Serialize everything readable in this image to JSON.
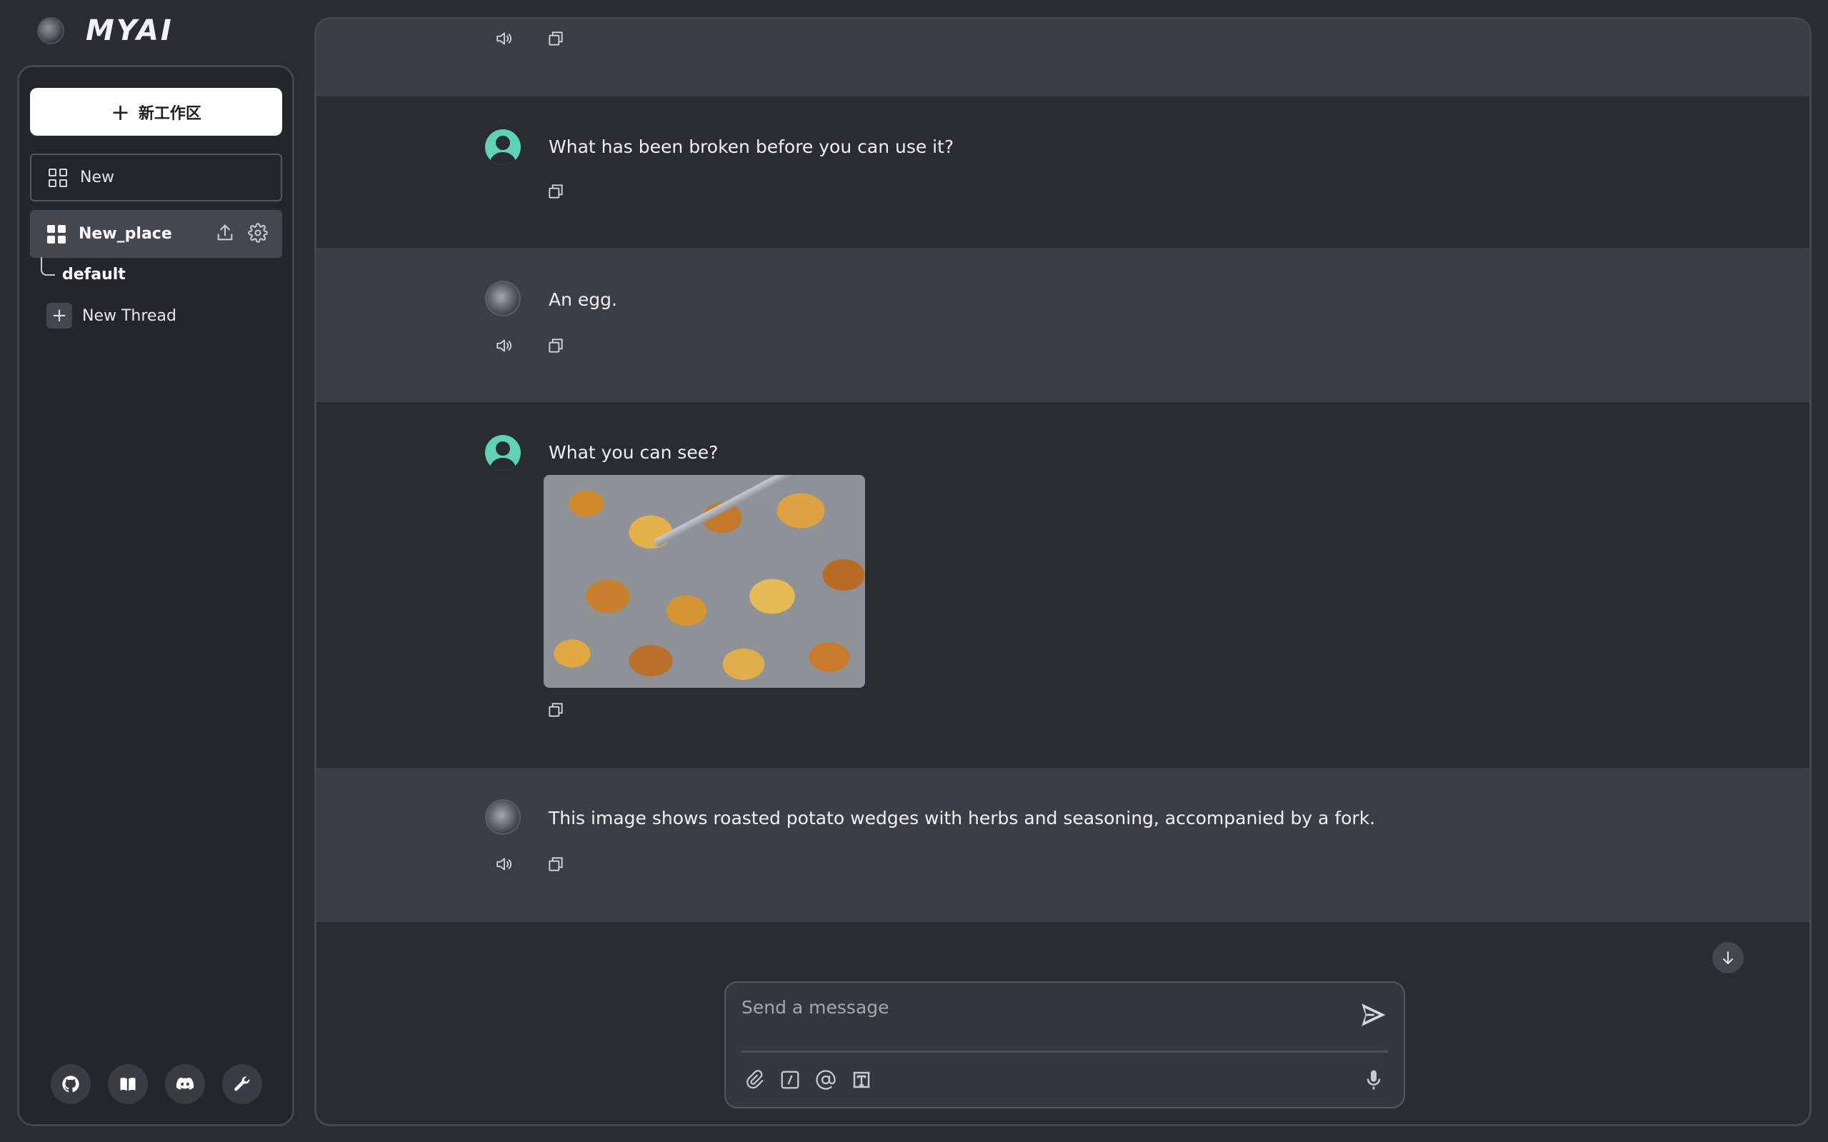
{
  "app": {
    "name": "MYAI"
  },
  "sidebar": {
    "new_workspace_label": "新工作区",
    "workspaces": [
      {
        "label": "New"
      },
      {
        "label": "New_place"
      }
    ],
    "thread_default": "default",
    "new_thread_label": "New Thread",
    "footer_icons": [
      "github-icon",
      "book-icon",
      "discord-icon",
      "wrench-icon"
    ]
  },
  "chat": {
    "messages": [
      {
        "role": "user",
        "text": "What has been broken before you can use it?"
      },
      {
        "role": "assistant",
        "text": "An egg."
      },
      {
        "role": "user",
        "text": "What you can see?"
      },
      {
        "role": "assistant",
        "text": "This image shows roasted potato wedges with herbs and seasoning, accompanied by a fork."
      }
    ]
  },
  "composer": {
    "placeholder": "Send a message"
  },
  "colors": {
    "accent_user_avatar": "#5fd3b3",
    "background": "#2b2c30",
    "bot_row": "#3c3e43"
  }
}
